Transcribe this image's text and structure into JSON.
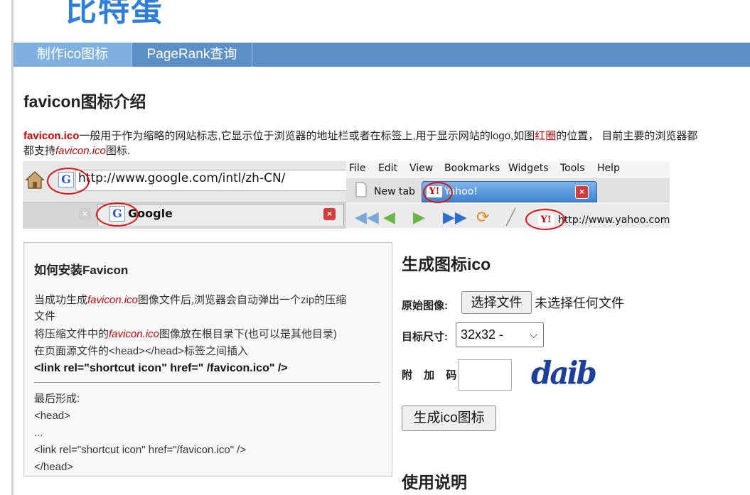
{
  "site": {
    "logo_text": "比特蛋"
  },
  "nav": {
    "items": [
      "制作ico图标",
      "PageRank查询"
    ]
  },
  "intro": {
    "heading": "favicon图标介绍",
    "brand": "favicon.ico",
    "text1": "一般用于作为缩略的网站标志,它显示位于浏览器的地址栏或者在标签上,用于显示网站的logo,如图",
    "red_circle": "红圈",
    "text2": "的位置， 目前主要的浏览器都",
    "line2_pre": "都支持",
    "line2_italic": "favicon.ico",
    "line2_post": "图标."
  },
  "browser_example": {
    "left_url": "http://www.google.com/intl/zh-CN/",
    "left_tab": "Google",
    "menu": [
      "File",
      "Edit",
      "View",
      "Bookmarks",
      "Widgets",
      "Tools",
      "Help"
    ],
    "new_tab": "New tab",
    "yahoo_tab": "Yahoo!",
    "yahoo_url": "http://www.yahoo.com",
    "google_glyph": "G",
    "yahoo_glyph": "Y!"
  },
  "install": {
    "title": "如何安装Favicon",
    "l1_pre": "当成功生成",
    "l1_it": "favicon.ico",
    "l1_post": "图像文件后,浏览器会自动弹出一个zip的压缩",
    "l1_cont": "文件",
    "l2_pre": "将压缩文件中的",
    "l2_it": "favicon.ico",
    "l2_post": "图像放在根目录下(也可以是其他目录)",
    "l3": "在页面源文件的<head></head>标签之间插入",
    "code": "<link rel=\"shortcut icon\" href=\" /favicon.ico\" />",
    "final_label": "最后形成:",
    "final_1": "<head>",
    "final_2": "...",
    "final_3": "<link rel=\"shortcut icon\" href=\"/favicon.ico\" />",
    "final_4": "</head>"
  },
  "form": {
    "heading": "生成图标ico",
    "source_label": "原始图像:",
    "file_button": "选择文件",
    "no_file": "未选择任何文件",
    "size_label": "目标尺寸:",
    "size_value": "32x32 -",
    "code_label": "附 加 码:",
    "captcha_text": "daib",
    "submit": "生成ico图标"
  },
  "usage": {
    "heading": "使用说明"
  }
}
